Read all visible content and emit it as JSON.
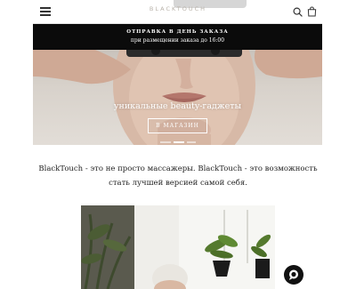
{
  "header": {
    "logo_text": "BLACKTOUCH",
    "icons": [
      "menu-icon",
      "search-icon",
      "cart-icon"
    ]
  },
  "announcement": {
    "line1": "ОТПРАВКА В ДЕНЬ ЗАКАЗА",
    "line2": "при размещении заказа до 16:00"
  },
  "hero": {
    "caption": "уникальные beauty-гаджеты",
    "button_label": "В МАГАЗИН",
    "slides_count": 3,
    "active_slide": 2
  },
  "intro": {
    "text": "BlackTouch - это не просто массажеры. BlackTouch - это возможность стать лучшей версией самой себя."
  },
  "chat": {
    "icon": "chat-bubble-icon"
  },
  "colors": {
    "background": "#ffffff",
    "announcement_bg": "#0b0b0b",
    "accent_text": "#1a1a1a"
  }
}
